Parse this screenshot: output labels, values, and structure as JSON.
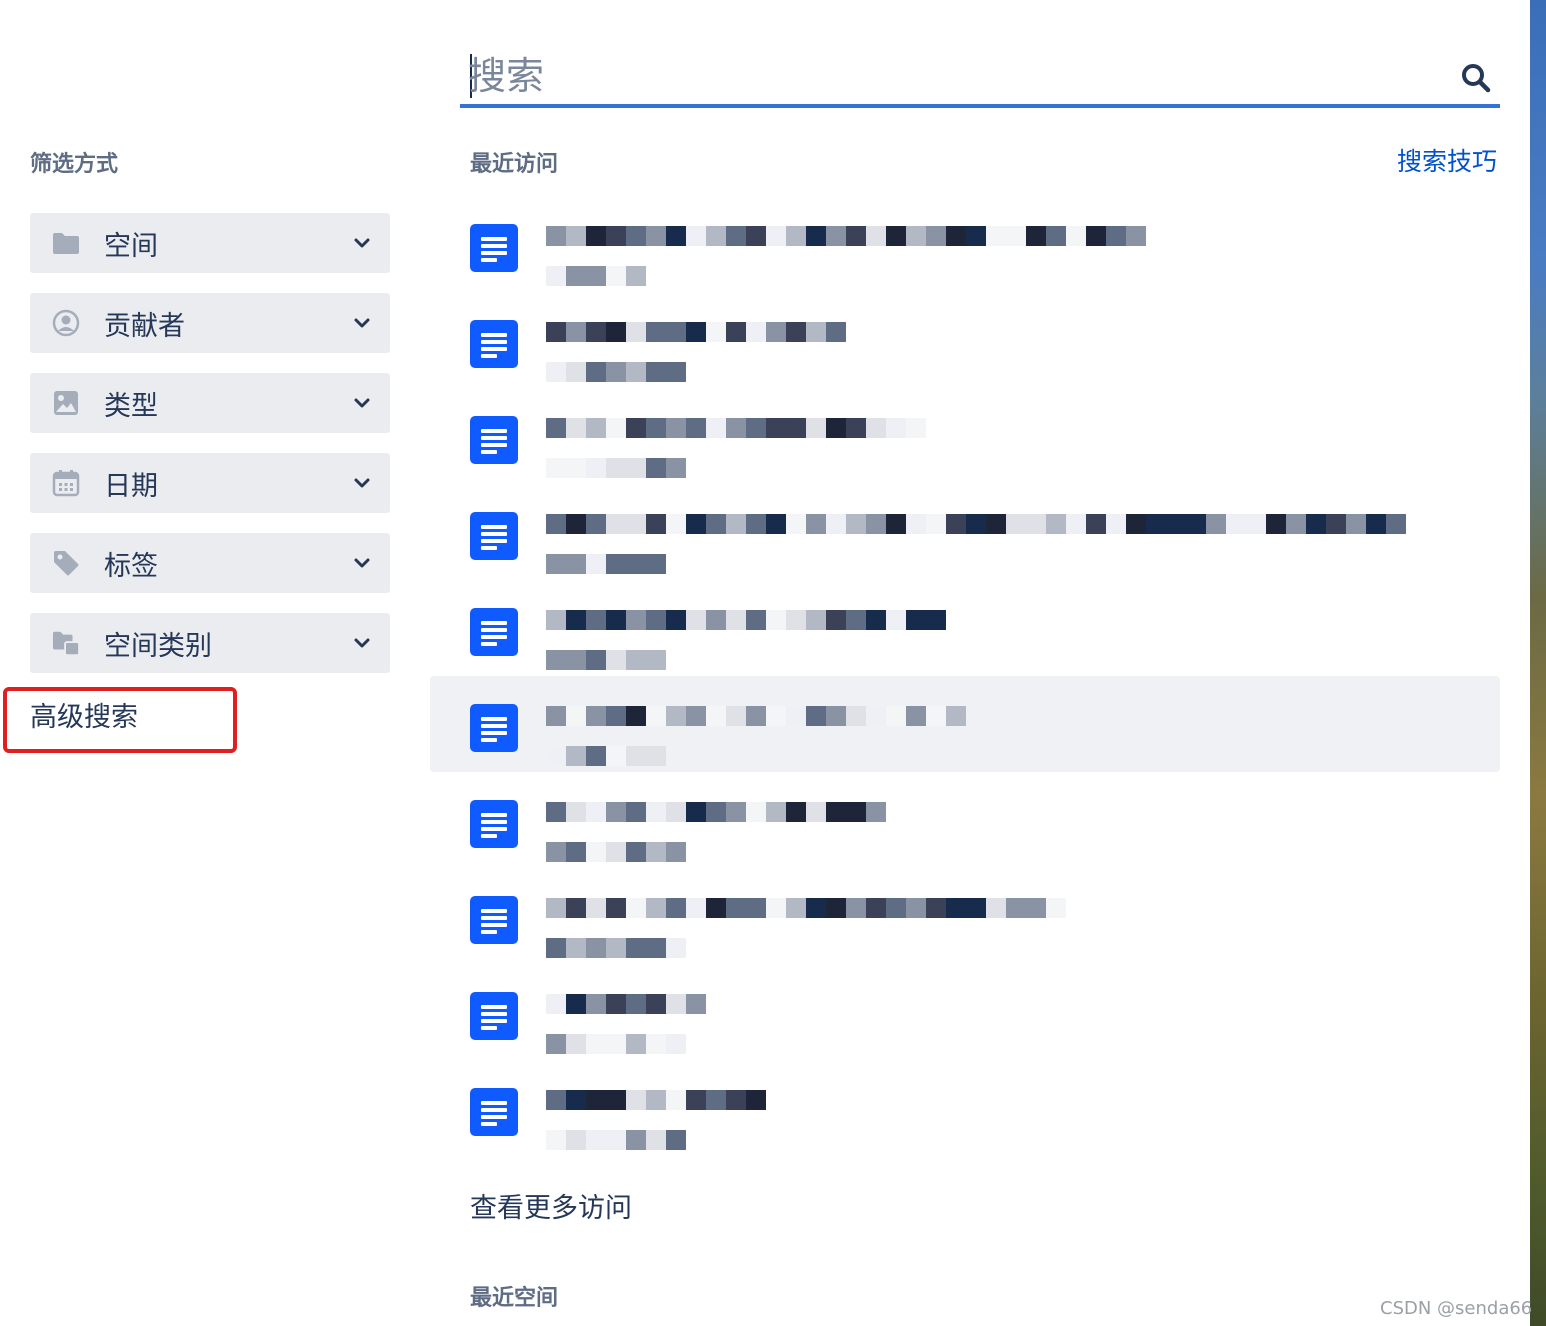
{
  "search": {
    "placeholder": "搜索"
  },
  "filters": {
    "title": "筛选方式",
    "items": [
      {
        "label": "空间",
        "icon": "folder-icon"
      },
      {
        "label": "贡献者",
        "icon": "user-circle-icon"
      },
      {
        "label": "类型",
        "icon": "image-icon"
      },
      {
        "label": "日期",
        "icon": "calendar-icon"
      },
      {
        "label": "标签",
        "icon": "tag-icon"
      },
      {
        "label": "空间类别",
        "icon": "folders-icon"
      }
    ],
    "advanced_search": "高级搜索"
  },
  "recent": {
    "title": "最近访问",
    "tips_label": "搜索技巧",
    "items": [
      {
        "icon": "document-icon"
      },
      {
        "icon": "document-icon"
      },
      {
        "icon": "document-icon"
      },
      {
        "icon": "document-icon"
      },
      {
        "icon": "document-icon"
      },
      {
        "icon": "document-icon"
      },
      {
        "icon": "document-icon"
      },
      {
        "icon": "document-icon"
      },
      {
        "icon": "document-icon"
      },
      {
        "icon": "document-icon"
      }
    ],
    "view_more": "查看更多访问"
  },
  "recent_spaces": {
    "title": "最近空间"
  },
  "watermark": "CSDN @senda66",
  "colors": {
    "accent": "#0052cc",
    "doc_icon": "#0f5bff",
    "search_underline": "#3572d6",
    "highlight_box": "#e02020"
  }
}
